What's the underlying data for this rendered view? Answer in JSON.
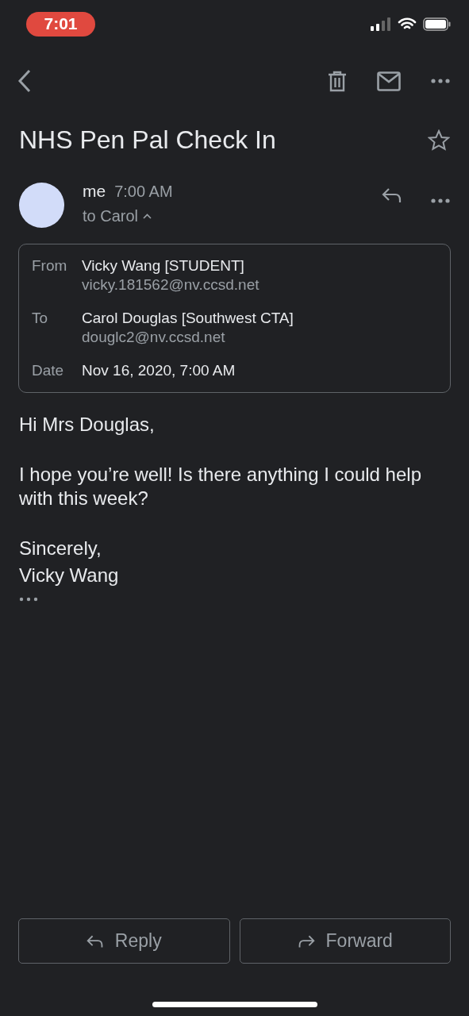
{
  "status_bar": {
    "time": "7:01",
    "recording": true
  },
  "subject": {
    "title": "NHS Pen Pal Check In",
    "starred": false
  },
  "message": {
    "sender": "me",
    "time": "7:00 AM",
    "recipient": "to Carol",
    "details_expanded": true
  },
  "details": [
    {
      "label": "From",
      "name": "Vicky Wang [STUDENT]",
      "address": "vicky.181562@nv.ccsd.net"
    },
    {
      "label": "To",
      "name": "Carol Douglas [Southwest CTA]",
      "address": "douglc2@nv.ccsd.net"
    },
    {
      "label": "Date",
      "name": "Nov 16, 2020, 7:00 AM"
    }
  ],
  "body": [
    [
      "Hi Mrs Douglas,"
    ],
    [
      "I hope you’re well! Is there anything I could help with this week?"
    ],
    [
      "Sincerely,",
      "Vicky Wang"
    ]
  ],
  "actions": [
    {
      "kind": "reply",
      "label": "Reply"
    },
    {
      "kind": "forward",
      "label": "Forward"
    }
  ]
}
